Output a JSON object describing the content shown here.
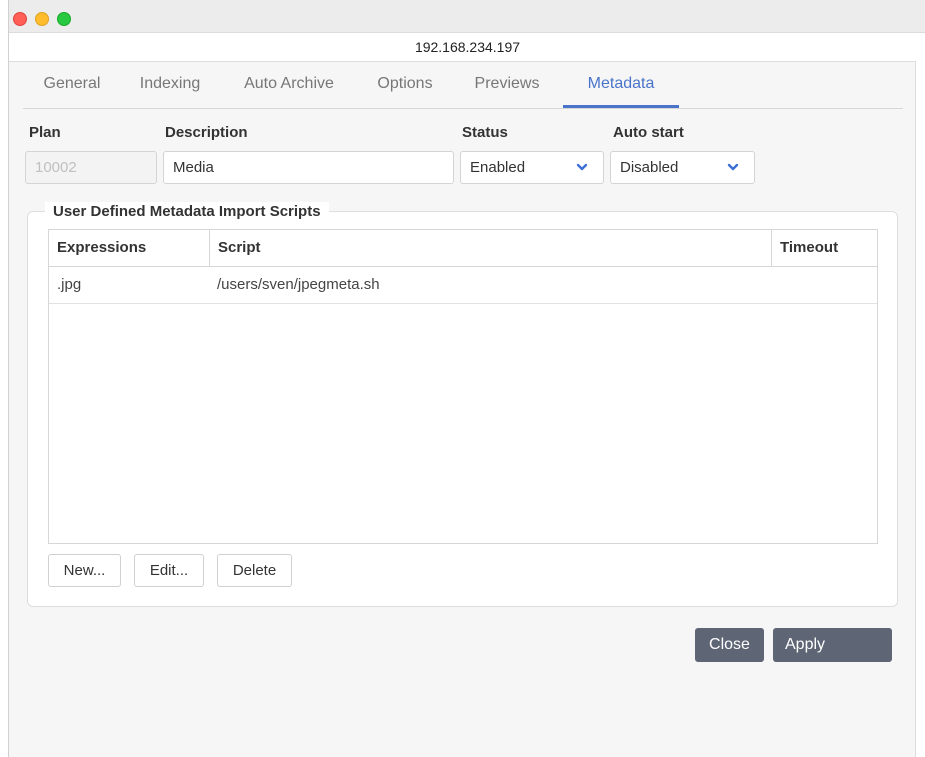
{
  "window": {
    "address": "192.168.234.197"
  },
  "tabs": [
    {
      "label": "General"
    },
    {
      "label": "Indexing"
    },
    {
      "label": "Auto Archive"
    },
    {
      "label": "Options"
    },
    {
      "label": "Previews"
    },
    {
      "label": "Metadata",
      "active": true
    }
  ],
  "form": {
    "plan_label": "Plan",
    "plan_value": "10002",
    "description_label": "Description",
    "description_value": "Media",
    "status_label": "Status",
    "status_value": "Enabled",
    "auto_start_label": "Auto start",
    "auto_start_value": "Disabled"
  },
  "scripts_group": {
    "title": "User Defined Metadata Import Scripts",
    "columns": [
      "Expressions",
      "Script",
      "Timeout"
    ],
    "rows": [
      {
        "expression": ".jpg",
        "script": "/users/sven/jpegmeta.sh",
        "timeout": ""
      }
    ],
    "new_label": "New...",
    "edit_label": "Edit...",
    "delete_label": "Delete"
  },
  "footer": {
    "close_label": "Close",
    "apply_label": "Apply"
  },
  "colors": {
    "accent": "#4a74c9",
    "dark_button": "#5e6675"
  }
}
